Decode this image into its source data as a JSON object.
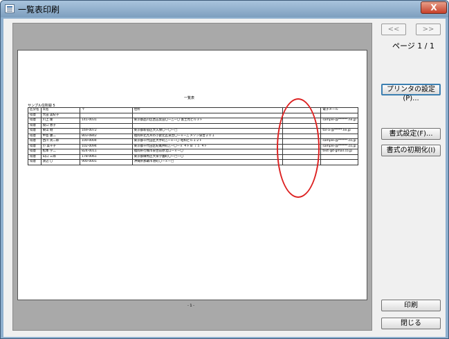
{
  "window": {
    "title": "一覧表印刷",
    "close_label": "X"
  },
  "nav": {
    "prev_label": "<<",
    "next_label": ">>",
    "page_label": "ページ 1 / 1"
  },
  "buttons": {
    "printer_settings": "プリンタの設定(P)...",
    "format_settings": "書式設定(F)...",
    "format_reset": "書式の初期化(I)",
    "print": "印刷",
    "close": "閉じる"
  },
  "document": {
    "title": "一覧表",
    "subtitle": "サンプル住所録 5",
    "page_number": "- 1 -",
    "headers": [
      "区分名",
      "氏名",
      "〒",
      "住所",
      "",
      "電子メール"
    ],
    "rows": [
      [
        "得意",
        "大田 美紀子",
        "",
        "",
        "",
        ""
      ],
      [
        "得意",
        "川上 隆",
        "141-0031",
        "東京都品川区西五反田〇ー△ー〇 富士見ビル３Ｆ",
        "",
        "sample-@******.ne.jp"
      ],
      [
        "得意",
        "坂口 恵子",
        "",
        "",
        "",
        ""
      ],
      [
        "得意",
        "東山 剛",
        "169-0072",
        "東京都新宿区大久保〇ー〇ー□",
        "",
        "tor-a-@*****.ne.jp"
      ],
      [
        "得意",
        "中島 康二",
        "803-0842",
        "福岡県北九州市小倉北区泉台〇ー×ー△ メゾン泉台２０１",
        "",
        ""
      ],
      [
        "得意",
        "西川 英二郎",
        "100-0004",
        "東京都千代田区大手町△ー×ー〇 昭和ビル１２Ｆ",
        "",
        "sample-@******.co.jp"
      ],
      [
        "得意",
        "小 美千子",
        "102-0094",
        "東京都千代田区紀尾井町△ー〇ー×  ４ＦＢ ７５ ４Ｆ",
        "",
        "sample-@******.co.jp"
      ],
      [
        "得意",
        "松本 学二",
        "824-0011",
        "福岡県行橋市泉台前原北口ー×ー〇",
        "",
        "test-@t-gmail.co.jp"
      ],
      [
        "得意",
        "山口 三郎",
        "178-0061",
        "東京都練馬区大泉学園町〇ー□ー〇",
        "",
        ""
      ],
      [
        "得意",
        "渡辺 〇",
        "900-0001",
        "沖縄県那覇市港町〇ー×ー□",
        "",
        ""
      ]
    ]
  }
}
